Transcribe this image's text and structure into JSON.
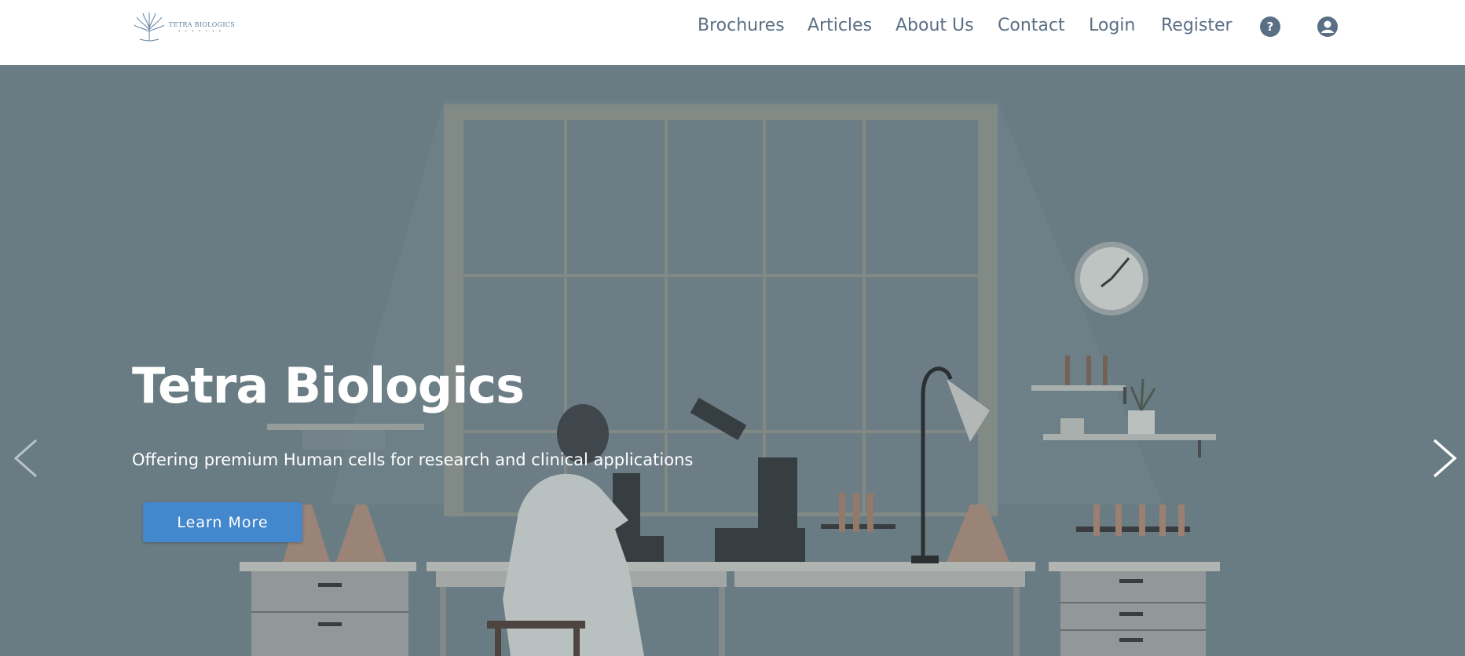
{
  "logo": {
    "name": "TETRA BIOLOGICS",
    "tagline": "• • • • • • •"
  },
  "nav": {
    "links": [
      "Brochures",
      "Articles",
      "About Us",
      "Contact",
      "Login",
      "Register"
    ],
    "help_icon": "question-circle-icon",
    "account_icon": "user-circle-icon"
  },
  "hero": {
    "title": "Tetra Biologics",
    "subtitle": "Offering premium Human cells for research and clinical applications",
    "cta_label": "Learn More"
  },
  "colors": {
    "nav_text": "#5a6f85",
    "hero_overlay": "#6e8086",
    "cta": "#4387cc"
  }
}
